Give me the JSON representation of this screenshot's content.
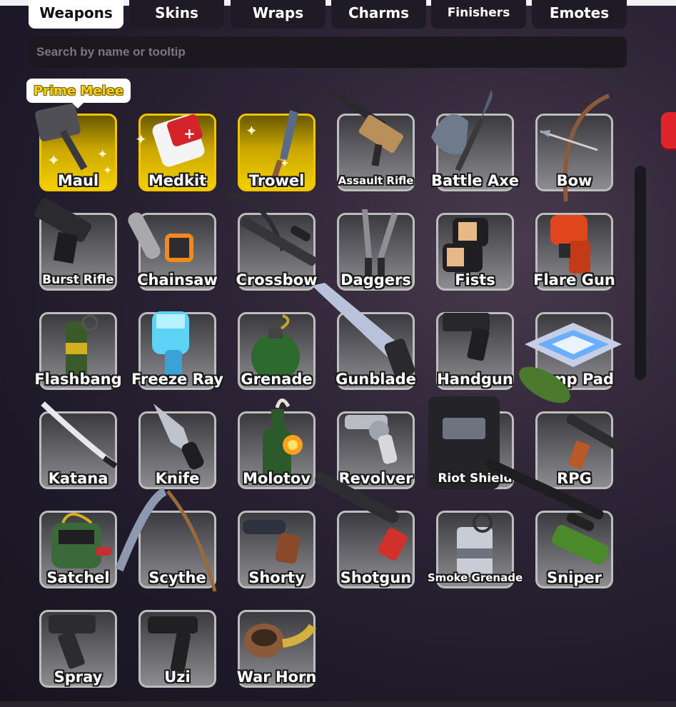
{
  "tabs": [
    {
      "label": "Weapons",
      "active": true
    },
    {
      "label": "Skins",
      "active": false
    },
    {
      "label": "Wraps",
      "active": false
    },
    {
      "label": "Charms",
      "active": false
    },
    {
      "label": "Finishers",
      "active": false
    },
    {
      "label": "Emotes",
      "active": false
    }
  ],
  "search": {
    "placeholder": "Search by name or tooltip"
  },
  "tooltip": {
    "label": "Prime Melee"
  },
  "items": [
    {
      "name": "Maul",
      "prime": true,
      "icon": "maul-icon"
    },
    {
      "name": "Medkit",
      "prime": true,
      "icon": "medkit-icon"
    },
    {
      "name": "Trowel",
      "prime": true,
      "icon": "trowel-icon"
    },
    {
      "name": "Assault Rifle",
      "prime": false,
      "icon": "assault-rifle-icon"
    },
    {
      "name": "Battle Axe",
      "prime": false,
      "icon": "battle-axe-icon"
    },
    {
      "name": "Bow",
      "prime": false,
      "icon": "bow-icon"
    },
    {
      "name": "Burst Rifle",
      "prime": false,
      "icon": "burst-rifle-icon"
    },
    {
      "name": "Chainsaw",
      "prime": false,
      "icon": "chainsaw-icon"
    },
    {
      "name": "Crossbow",
      "prime": false,
      "icon": "crossbow-icon"
    },
    {
      "name": "Daggers",
      "prime": false,
      "icon": "daggers-icon"
    },
    {
      "name": "Fists",
      "prime": false,
      "icon": "fists-icon"
    },
    {
      "name": "Flare Gun",
      "prime": false,
      "icon": "flare-gun-icon"
    },
    {
      "name": "Flashbang",
      "prime": false,
      "icon": "flashbang-icon"
    },
    {
      "name": "Freeze Ray",
      "prime": false,
      "icon": "freeze-ray-icon"
    },
    {
      "name": "Grenade",
      "prime": false,
      "icon": "grenade-icon"
    },
    {
      "name": "Gunblade",
      "prime": false,
      "icon": "gunblade-icon"
    },
    {
      "name": "Handgun",
      "prime": false,
      "icon": "handgun-icon"
    },
    {
      "name": "Jump Pad",
      "prime": false,
      "icon": "jump-pad-icon"
    },
    {
      "name": "Katana",
      "prime": false,
      "icon": "katana-icon"
    },
    {
      "name": "Knife",
      "prime": false,
      "icon": "knife-icon"
    },
    {
      "name": "Molotov",
      "prime": false,
      "icon": "molotov-icon"
    },
    {
      "name": "Revolver",
      "prime": false,
      "icon": "revolver-icon"
    },
    {
      "name": "Riot Shield",
      "prime": false,
      "icon": "riot-shield-icon"
    },
    {
      "name": "RPG",
      "prime": false,
      "icon": "rpg-icon"
    },
    {
      "name": "Satchel",
      "prime": false,
      "icon": "satchel-icon"
    },
    {
      "name": "Scythe",
      "prime": false,
      "icon": "scythe-icon"
    },
    {
      "name": "Shorty",
      "prime": false,
      "icon": "shorty-icon"
    },
    {
      "name": "Shotgun",
      "prime": false,
      "icon": "shotgun-icon"
    },
    {
      "name": "Smoke Grenade",
      "prime": false,
      "icon": "smoke-grenade-icon"
    },
    {
      "name": "Sniper",
      "prime": false,
      "icon": "sniper-icon"
    },
    {
      "name": "Spray",
      "prime": false,
      "icon": "spray-icon"
    },
    {
      "name": "Uzi",
      "prime": false,
      "icon": "uzi-icon"
    },
    {
      "name": "War Horn",
      "prime": false,
      "icon": "war-horn-icon"
    }
  ],
  "colors": {
    "prime_border": "#f3c500",
    "prime_fill": "#f4d000",
    "active_tab": "#ffffff",
    "tooltip_text": "#f2d21e",
    "close_button": "#e0242b"
  }
}
